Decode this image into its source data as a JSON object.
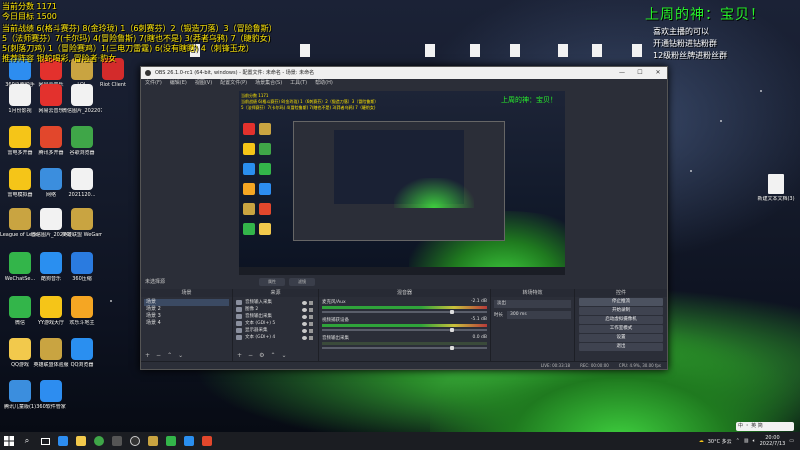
{
  "overlay_left": {
    "lines": [
      "当前分数 1171",
      "今日目标 1500",
      "当前战绩 6(格斗赛芬) 8(金玲珑) 1（6刺赛芬）2（锻造刀落）3（冒险鲁斯）",
      "5（法师赛芬）7(卡尔玛) 4(冒险鲁斯) 7(瞎也不是) 3(莽者乌鸦) 7（睫豹女)",
      "5(刺落刀鸡) 1（冒险赛鸡）1(三电刀雷霆) 6(没有瞎瞎) 4（刺锋玉龙）",
      "推荐阵容 银蛇喝彩, 冒险者·豹女"
    ]
  },
  "overlay_right": {
    "title": "上周的神：宝贝！",
    "lines": [
      "喜欢主播的可以",
      "开通钻粉进钻粉群",
      "12级粉丝牌进粉丝群"
    ]
  },
  "desktop_icons_left": [
    {
      "label": "360桌面助手",
      "color": "#2d8df0"
    },
    {
      "label": "网易云音乐",
      "color": "#e3312d"
    },
    {
      "label": "LOL",
      "color": "#c9a441"
    },
    {
      "label": "Riot Client",
      "color": "#d32b2b"
    },
    {
      "label": "1月份影视",
      "color": "#f2f2f2"
    },
    {
      "label": "网易云音乐",
      "color": "#e3312d"
    },
    {
      "label": "微信图片_202207",
      "color": "#f2f2f2"
    },
    {
      "label": "雷电多开器",
      "color": "#f5c518"
    },
    {
      "label": "腾讯多开器",
      "color": "#e2472c"
    },
    {
      "label": "谷歌浏览器",
      "color": "#3fa648"
    },
    {
      "label": "雷电模拟器",
      "color": "#f5c518"
    },
    {
      "label": "网络",
      "color": "#3b8ede"
    },
    {
      "label": "2021120...",
      "color": "#f2f2f2"
    },
    {
      "label": "League of Legends",
      "color": "#c9a441"
    },
    {
      "label": "微信图片_2022021...",
      "color": "#f2f2f2"
    },
    {
      "label": "英雄联盟 WeGame版",
      "color": "#c9a441"
    },
    {
      "label": "WeChatSe...",
      "color": "#33b54a"
    },
    {
      "label": "酷狗音乐",
      "color": "#2a8ff0"
    },
    {
      "label": "360压缩",
      "color": "#2a7be0"
    },
    {
      "label": "微信",
      "color": "#33b54a"
    },
    {
      "label": "YY游戏大厅",
      "color": "#f5c518"
    },
    {
      "label": "欢乐斗地主",
      "color": "#f5a623"
    },
    {
      "label": "QQ游戏",
      "color": "#f2c94c"
    },
    {
      "label": "英雄联盟体验服",
      "color": "#c9a441"
    },
    {
      "label": "QQ浏览器",
      "color": "#2a8ff0"
    },
    {
      "label": "腾讯儿童版(1)",
      "color": "#3b8ede"
    },
    {
      "label": "360软件管家",
      "color": "#2d8df0"
    }
  ],
  "desktop_icon_right": {
    "label": "新建文本文档(3)"
  },
  "obs": {
    "title": "OBS 26.1.0-rc1 (64-bit, windows) - 配置文件: 未命名 - 场景: 未命名",
    "menu": [
      "文件(F)",
      "编辑(E)",
      "视图(V)",
      "配置文件(P)",
      "场景集合(S)",
      "工具(T)",
      "帮助(H)"
    ],
    "scene_label": "未选择源",
    "props_label": "属性",
    "filters_label": "滤镜",
    "docks": {
      "scenes": {
        "title": "场景",
        "items": [
          "场景",
          "场景 2",
          "场景 3",
          "场景 4"
        ]
      },
      "sources": {
        "title": "来源",
        "items": [
          "音频输入采集",
          "图像 2",
          "音频输出采集",
          "文本 (GDI+) 5",
          "显示器采集",
          "文本 (GDI+) 4"
        ]
      },
      "mixer": {
        "title": "混音器",
        "channels": [
          {
            "name": "麦克风/Aux",
            "level": "-2.1 dB"
          },
          {
            "name": "视频捕获设备",
            "level": "-5.1 dB"
          },
          {
            "name": "音频输出采集",
            "level": "0.0 dB"
          }
        ]
      },
      "transitions": {
        "title": "转场特效",
        "selected": "淡出",
        "duration_label": "时长",
        "duration_value": "300 ms"
      },
      "controls": {
        "title": "控件",
        "buttons": [
          "停止推流",
          "开始录制",
          "启动虚拟摄像机",
          "工作室模式",
          "设置",
          "退出"
        ]
      }
    },
    "status": {
      "live": "LIVE: 00:33:18",
      "rec": "REC: 00:00:00",
      "cpu": "CPU: 4.9%, 30.00 fps"
    }
  },
  "taskbar": {
    "weather": "30°C 多云",
    "time": "20:00",
    "date": "2022/7/13"
  },
  "ime": "中 ・ 英 简"
}
